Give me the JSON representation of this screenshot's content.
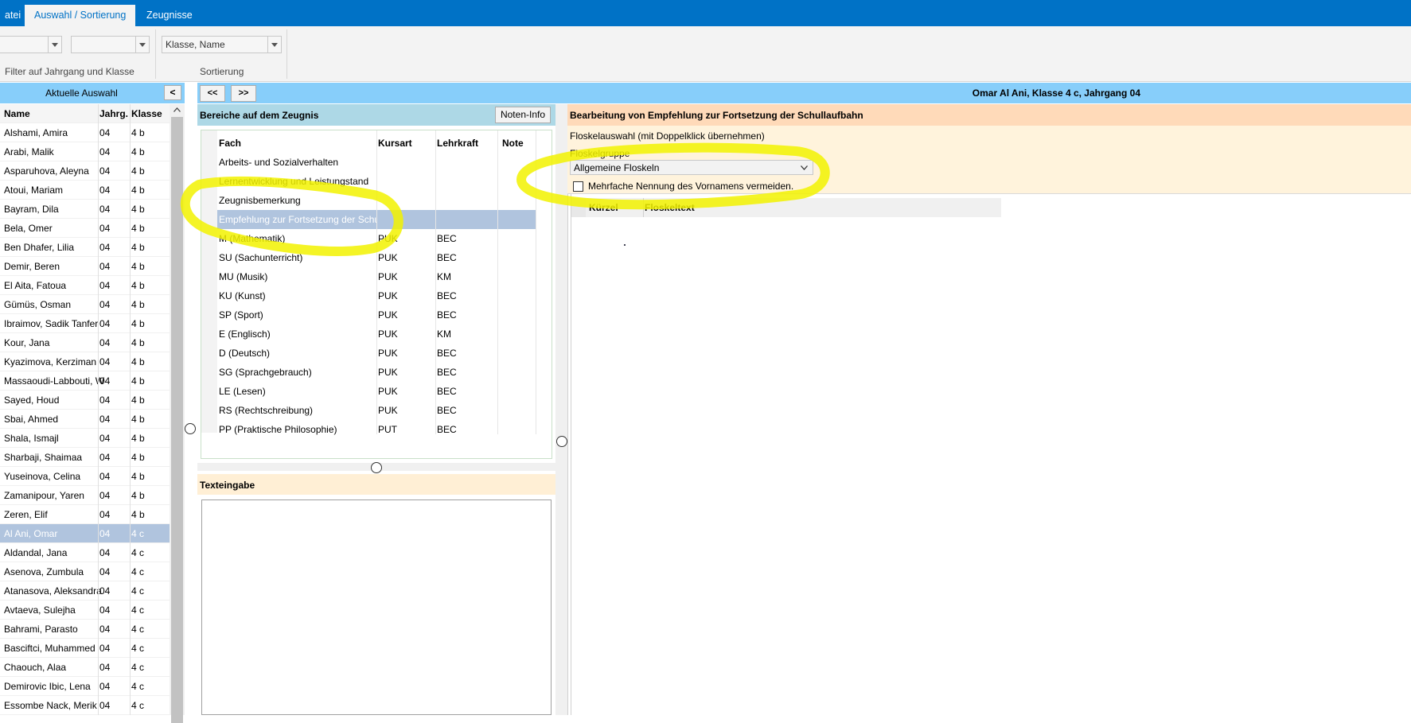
{
  "ribbon": {
    "tabs": [
      {
        "label": "atei",
        "active": false
      },
      {
        "label": "Auswahl / Sortierung",
        "active": true
      },
      {
        "label": "Zeugnisse",
        "active": false
      }
    ],
    "sort_combo_value": "Klasse, Name",
    "filter_group_label": "Filter auf Jahrgang und Klasse",
    "sort_group_label": "Sortierung"
  },
  "left": {
    "title": "Aktuelle Auswahl",
    "collapse_label": "<",
    "columns": [
      "Name",
      "Jahrg.",
      "Klasse"
    ],
    "rows": [
      {
        "name": "Alshami, Amira",
        "jahrg": "04",
        "klasse": "4 b"
      },
      {
        "name": "Arabi, Malik",
        "jahrg": "04",
        "klasse": "4 b"
      },
      {
        "name": "Asparuhova, Aleyna",
        "jahrg": "04",
        "klasse": "4 b"
      },
      {
        "name": "Atoui, Mariam",
        "jahrg": "04",
        "klasse": "4 b"
      },
      {
        "name": "Bayram, Dila",
        "jahrg": "04",
        "klasse": "4 b"
      },
      {
        "name": "Bela, Omer",
        "jahrg": "04",
        "klasse": "4 b"
      },
      {
        "name": "Ben Dhafer, Lilia",
        "jahrg": "04",
        "klasse": "4 b"
      },
      {
        "name": "Demir, Beren",
        "jahrg": "04",
        "klasse": "4 b"
      },
      {
        "name": "El Aita, Fatoua",
        "jahrg": "04",
        "klasse": "4 b"
      },
      {
        "name": "Gümüs, Osman",
        "jahrg": "04",
        "klasse": "4 b"
      },
      {
        "name": "Ibraimov, Sadik Tanfer",
        "jahrg": "04",
        "klasse": "4 b"
      },
      {
        "name": "Kour, Jana",
        "jahrg": "04",
        "klasse": "4 b"
      },
      {
        "name": "Kyazimova, Kerziman",
        "jahrg": "04",
        "klasse": "4 b"
      },
      {
        "name": "Massaoudi-Labbouti, W",
        "jahrg": "04",
        "klasse": "4 b"
      },
      {
        "name": "Sayed, Houd",
        "jahrg": "04",
        "klasse": "4 b"
      },
      {
        "name": "Sbai, Ahmed",
        "jahrg": "04",
        "klasse": "4 b"
      },
      {
        "name": "Shala, Ismajl",
        "jahrg": "04",
        "klasse": "4 b"
      },
      {
        "name": "Sharbaji, Shaimaa",
        "jahrg": "04",
        "klasse": "4 b"
      },
      {
        "name": "Yuseinova, Celina",
        "jahrg": "04",
        "klasse": "4 b"
      },
      {
        "name": "Zamanipour, Yaren",
        "jahrg": "04",
        "klasse": "4 b"
      },
      {
        "name": "Zeren, Elif",
        "jahrg": "04",
        "klasse": "4 b"
      },
      {
        "name": "Al Ani, Omar",
        "jahrg": "04",
        "klasse": "4 c",
        "selected": true
      },
      {
        "name": "Aldandal, Jana",
        "jahrg": "04",
        "klasse": "4 c"
      },
      {
        "name": "Asenova, Zumbula",
        "jahrg": "04",
        "klasse": "4 c"
      },
      {
        "name": "Atanasova, Aleksandra",
        "jahrg": "04",
        "klasse": "4 c"
      },
      {
        "name": "Avtaeva, Sulejha",
        "jahrg": "04",
        "klasse": "4 c"
      },
      {
        "name": "Bahrami, Parasto",
        "jahrg": "04",
        "klasse": "4 c"
      },
      {
        "name": "Basciftci, Muhammed",
        "jahrg": "04",
        "klasse": "4 c"
      },
      {
        "name": "Chaouch, Alaa",
        "jahrg": "04",
        "klasse": "4 c"
      },
      {
        "name": "Demirovic Ibic, Lena",
        "jahrg": "04",
        "klasse": "4 c"
      },
      {
        "name": "Essombe Nack, Merik",
        "jahrg": "04",
        "klasse": "4 c"
      }
    ]
  },
  "middle": {
    "prev_label": "<<",
    "next_label": ">>",
    "bereiche_title": "Bereiche auf dem Zeugnis",
    "noten_info_label": "Noten-Info",
    "columns": [
      "Fach",
      "Kursart",
      "Lehrkraft",
      "Note"
    ],
    "rows": [
      {
        "fach": "Arbeits- und Sozialverhalten",
        "kursart": "",
        "lehrkraft": "",
        "note": ""
      },
      {
        "fach": "Lernentwicklung und Leistungstand",
        "kursart": "",
        "lehrkraft": "",
        "note": ""
      },
      {
        "fach": "Zeugnisbemerkung",
        "kursart": "",
        "lehrkraft": "",
        "note": ""
      },
      {
        "fach": "Empfehlung zur Fortsetzung der Schu",
        "kursart": "",
        "lehrkraft": "",
        "note": "",
        "selected": true
      },
      {
        "fach": "M (Mathematik)",
        "kursart": "PUK",
        "lehrkraft": "BEC",
        "note": ""
      },
      {
        "fach": "SU (Sachunterricht)",
        "kursart": "PUK",
        "lehrkraft": "BEC",
        "note": ""
      },
      {
        "fach": "MU (Musik)",
        "kursart": "PUK",
        "lehrkraft": "KM",
        "note": ""
      },
      {
        "fach": "KU (Kunst)",
        "kursart": "PUK",
        "lehrkraft": "BEC",
        "note": ""
      },
      {
        "fach": "SP (Sport)",
        "kursart": "PUK",
        "lehrkraft": "BEC",
        "note": ""
      },
      {
        "fach": "E (Englisch)",
        "kursart": "PUK",
        "lehrkraft": "KM",
        "note": ""
      },
      {
        "fach": "D (Deutsch)",
        "kursart": "PUK",
        "lehrkraft": "BEC",
        "note": ""
      },
      {
        "fach": "SG (Sprachgebrauch)",
        "kursart": "PUK",
        "lehrkraft": "BEC",
        "note": ""
      },
      {
        "fach": "LE (Lesen)",
        "kursart": "PUK",
        "lehrkraft": "BEC",
        "note": ""
      },
      {
        "fach": "RS (Rechtschreibung)",
        "kursart": "PUK",
        "lehrkraft": "BEC",
        "note": ""
      },
      {
        "fach": "PP (Praktische Philosophie)",
        "kursart": "PUT",
        "lehrkraft": "BEC",
        "note": ""
      }
    ],
    "texteingabe_title": "Texteingabe"
  },
  "right": {
    "student_title": "Omar Al Ani, Klasse 4 c, Jahrgang 04",
    "bearbeitung_title": "Bearbeitung von Empfehlung zur Fortsetzung der Schullaufbahn",
    "floskelauswahl_label": "Floskelauswahl (mit Doppelklick übernehmen)",
    "floskelgruppe_label": "Floskelgruppe",
    "floskelgruppe_value": "Allgemeine Floskeln",
    "vorname_checkbox_label": "Mehrfache Nennung des Vornamens vermeiden.",
    "vorname_checked": false,
    "table_columns": [
      "Kürzel",
      "Floskeltext"
    ]
  },
  "colors": {
    "ribbon_blue": "#0072c6",
    "header_blue": "#87cefa",
    "light_blue": "#add8e6",
    "selection": "#b0c4de",
    "peach": "#ffdab9",
    "light_peach": "#ffefd5",
    "highlight_yellow": "#f2f200"
  }
}
